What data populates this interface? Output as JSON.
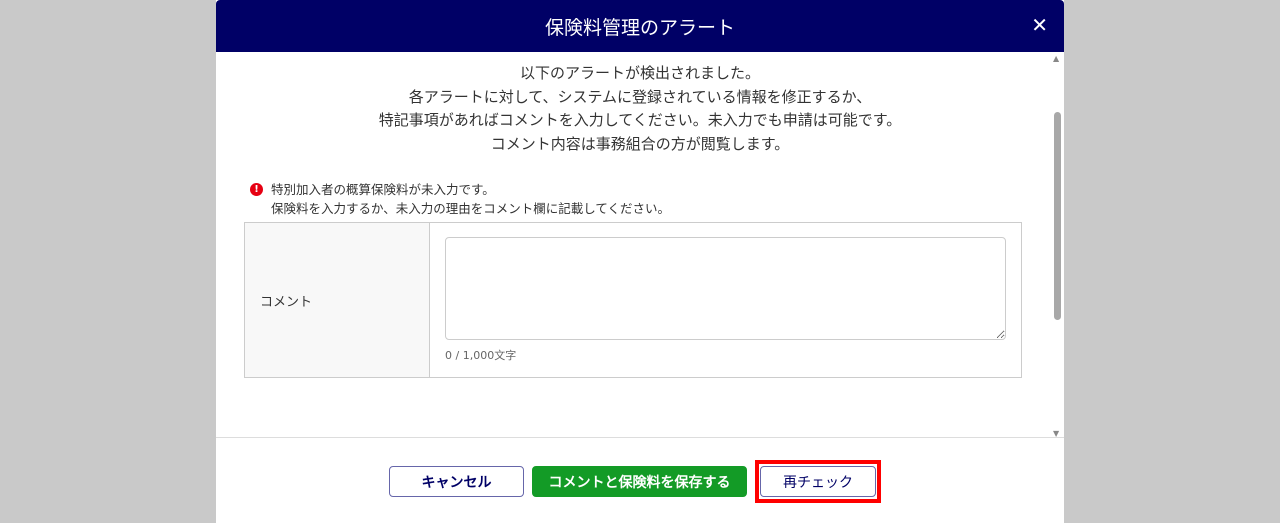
{
  "dialog": {
    "title": "保険料管理のアラート",
    "close_icon": "close-icon"
  },
  "intro": [
    "以下のアラートが検出されました。",
    "各アラートに対して、システムに登録されている情報を修正するか、",
    "特記事項があればコメントを入力してください。未入力でも申請は可能です。",
    "コメント内容は事務組合の方が閲覧します。"
  ],
  "alert": {
    "icon": "!",
    "line1": "特別加入者の概算保険料が未入力です。",
    "line2": "保険料を入力するか、未入力の理由をコメント欄に記載してください。"
  },
  "comment": {
    "label": "コメント",
    "value": "",
    "counter": "0 / 1,000文字"
  },
  "buttons": {
    "cancel": "キャンセル",
    "save": "コメントと保険料を保存する",
    "recheck": "再チェック"
  },
  "colors": {
    "header": "#000066",
    "save": "#139b26",
    "highlight": "#ff0000",
    "alert": "#e60012"
  }
}
